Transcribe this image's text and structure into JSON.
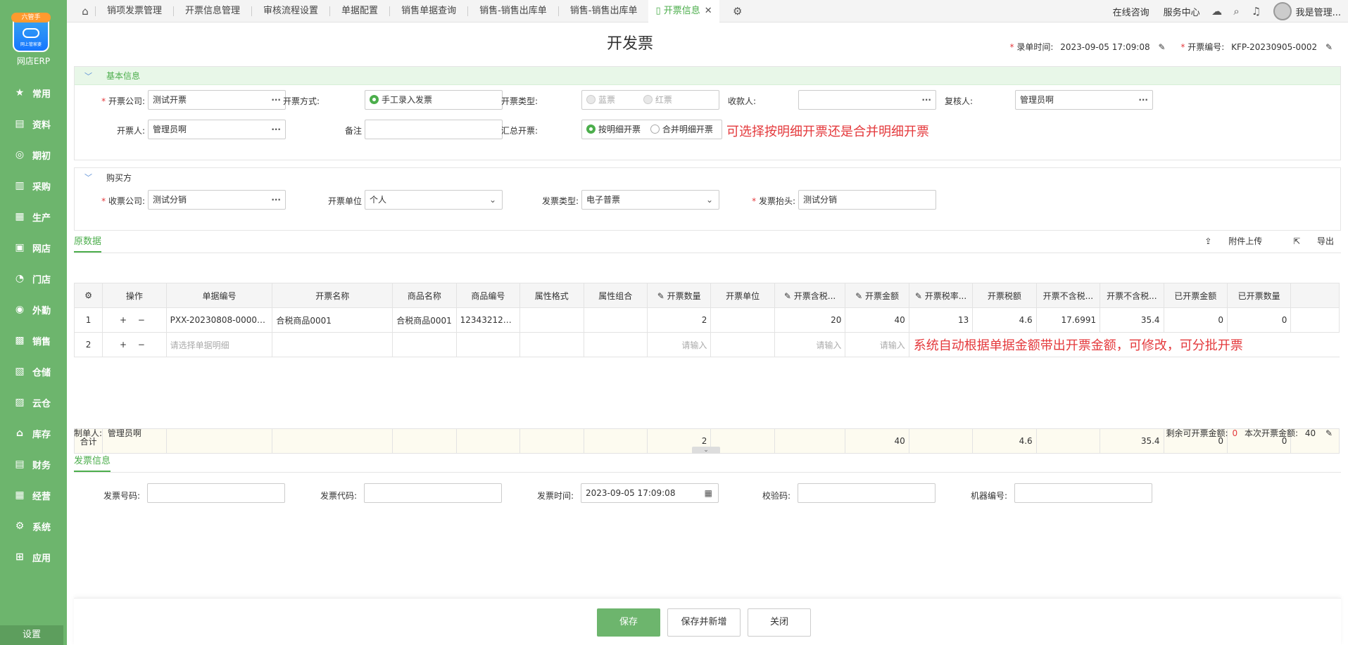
{
  "sidebar": {
    "badge": "六管手",
    "logo_text": "网上管家婆",
    "app_name": "网店ERP",
    "items": [
      {
        "label": "常用",
        "icon": "★"
      },
      {
        "label": "资料",
        "icon": "▤"
      },
      {
        "label": "期初",
        "icon": "◎"
      },
      {
        "label": "采购",
        "icon": "▥"
      },
      {
        "label": "生产",
        "icon": "▦"
      },
      {
        "label": "网店",
        "icon": "▣"
      },
      {
        "label": "门店",
        "icon": "◔"
      },
      {
        "label": "外勤",
        "icon": "◉"
      },
      {
        "label": "销售",
        "icon": "▩"
      },
      {
        "label": "仓储",
        "icon": "▧"
      },
      {
        "label": "云仓",
        "icon": "▨"
      },
      {
        "label": "库存",
        "icon": "⌂"
      },
      {
        "label": "财务",
        "icon": "▤"
      },
      {
        "label": "经营",
        "icon": "▦"
      },
      {
        "label": "系统",
        "icon": "⚙"
      },
      {
        "label": "应用",
        "icon": "⊞"
      }
    ],
    "settings": "设置"
  },
  "tabs": [
    "销项发票管理",
    "开票信息管理",
    "审核流程设置",
    "单据配置",
    "销售单据查询",
    "销售-销售出库单",
    "销售-销售出库单"
  ],
  "active_tab": "开票信息",
  "topright": {
    "consult": "在线咨询",
    "service": "服务中心",
    "user": "我是管理..."
  },
  "page": {
    "title": "开发票",
    "entry_time_label": "录单时间:",
    "entry_time": "2023-09-05 17:09:08",
    "invoice_no_label": "开票编号:",
    "invoice_no": "KFP-20230905-0002"
  },
  "basic": {
    "title": "基本信息",
    "company_label": "开票公司:",
    "company": "测试开票",
    "method_label": "开票方式:",
    "method": "手工录入发票",
    "type_label": "开票类型:",
    "type_blue": "蓝票",
    "type_red": "红票",
    "payee_label": "收款人:",
    "payee": "",
    "reviewer_label": "复核人:",
    "reviewer": "管理员啊",
    "drawer_label": "开票人:",
    "drawer": "管理员啊",
    "remark_label": "备注",
    "remark": "",
    "summary_label": "汇总开票:",
    "summary_detail": "按明细开票",
    "summary_merge": "合并明细开票",
    "note": "可选择按明细开票还是合并明细开票"
  },
  "buyer": {
    "title": "购买方",
    "company_label": "收票公司:",
    "company": "测试分销",
    "unit_label": "开票单位",
    "unit": "个人",
    "inv_type_label": "发票类型:",
    "inv_type": "电子普票",
    "header_label": "发票抬头:",
    "header": "测试分销"
  },
  "source": {
    "tab": "原数据",
    "upload": "附件上传",
    "export": "导出"
  },
  "table": {
    "headers": [
      "操作",
      "单据编号",
      "开票名称",
      "商品名称",
      "商品编号",
      "属性格式",
      "属性组合",
      "✎ 开票数量",
      "开票单位",
      "✎ 开票含税...",
      "✎ 开票金额",
      "✎ 开票税率...",
      "开票税额",
      "开票不含税...",
      "开票不含税...",
      "已开票金额",
      "已开票数量"
    ],
    "rows": [
      {
        "idx": "1",
        "ops": "+ −",
        "bill_no": "PXX-20230808-000000...",
        "inv_name": "合税商品0001",
        "goods_name": "合税商品0001",
        "goods_no": "1234321231...",
        "attr_fmt": "",
        "attr_combo": "",
        "qty": "2",
        "unit": "",
        "price_tax": "20",
        "amount": "40",
        "rate": "13",
        "tax": "4.6",
        "price_notax": "17.6991",
        "amount_notax": "35.4",
        "invoiced_amt": "0",
        "invoiced_qty": "0"
      },
      {
        "idx": "2",
        "ops": "+ −",
        "bill_no": "请选择单据明细",
        "qty": "请输入",
        "price_tax": "请输入",
        "amount": "请输入"
      }
    ],
    "note": "系统自动根据单据金额带出开票金额，可修改，可分批开票",
    "sum": {
      "label": "合计",
      "qty": "2",
      "amount": "40",
      "tax": "4.6",
      "amount_notax": "35.4",
      "invoiced_amt": "0",
      "invoiced_qty": "0"
    }
  },
  "footer": {
    "maker_label": "制单人:",
    "maker": "管理员啊",
    "remain_label": "剩余可开票金额:",
    "remain": "0",
    "this_label": "本次开票金额:",
    "this": "40"
  },
  "invoice_info": {
    "tab": "发票信息",
    "no_label": "发票号码:",
    "code_label": "发票代码:",
    "time_label": "发票时间:",
    "time": "2023-09-05 17:09:08",
    "check_label": "校验码:",
    "machine_label": "机器编号:"
  },
  "buttons": {
    "save": "保存",
    "save_new": "保存并新增",
    "close": "关闭"
  }
}
